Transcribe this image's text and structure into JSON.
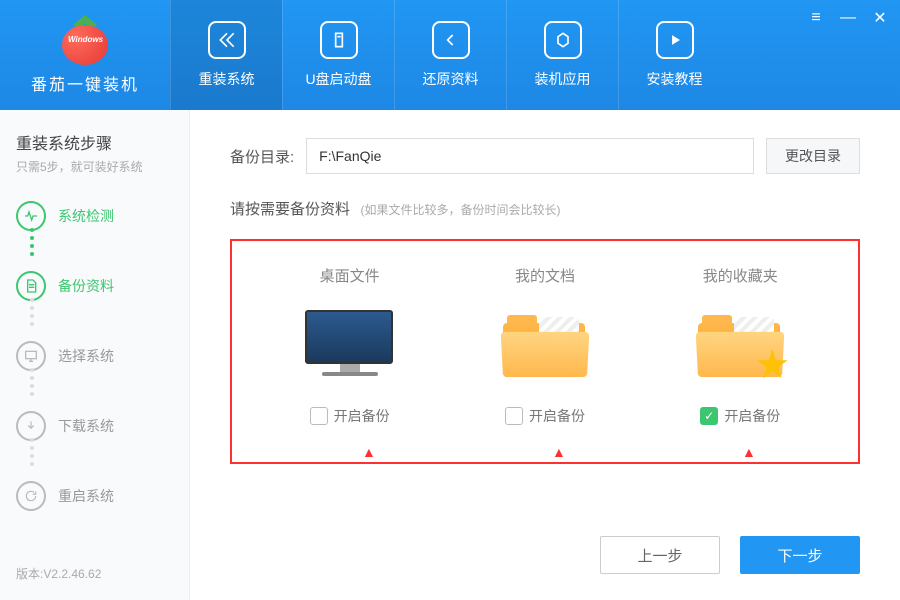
{
  "app": {
    "name": "番茄一键装机",
    "logo_badge": "Windows"
  },
  "nav": [
    {
      "label": "重装系统",
      "icon": "reinstall"
    },
    {
      "label": "U盘启动盘",
      "icon": "usb"
    },
    {
      "label": "还原资料",
      "icon": "restore"
    },
    {
      "label": "装机应用",
      "icon": "apps"
    },
    {
      "label": "安装教程",
      "icon": "tutorial"
    }
  ],
  "sidebar": {
    "title": "重装系统步骤",
    "subtitle": "只需5步，就可装好系统",
    "steps": [
      {
        "label": "系统检测",
        "state": "done"
      },
      {
        "label": "备份资料",
        "state": "done"
      },
      {
        "label": "选择系统",
        "state": "pending"
      },
      {
        "label": "下载系统",
        "state": "pending"
      },
      {
        "label": "重启系统",
        "state": "pending"
      }
    ],
    "version": "版本:V2.2.46.62"
  },
  "main": {
    "path_label": "备份目录:",
    "path_value": "F:\\FanQie",
    "change_dir": "更改目录",
    "instruction": "请按需要备份资料",
    "instruction_note": "(如果文件比较多，备份时间会比较长)",
    "items": [
      {
        "title": "桌面文件",
        "check_label": "开启备份",
        "checked": false
      },
      {
        "title": "我的文档",
        "check_label": "开启备份",
        "checked": false
      },
      {
        "title": "我的收藏夹",
        "check_label": "开启备份",
        "checked": true
      }
    ],
    "prev": "上一步",
    "next": "下一步"
  }
}
